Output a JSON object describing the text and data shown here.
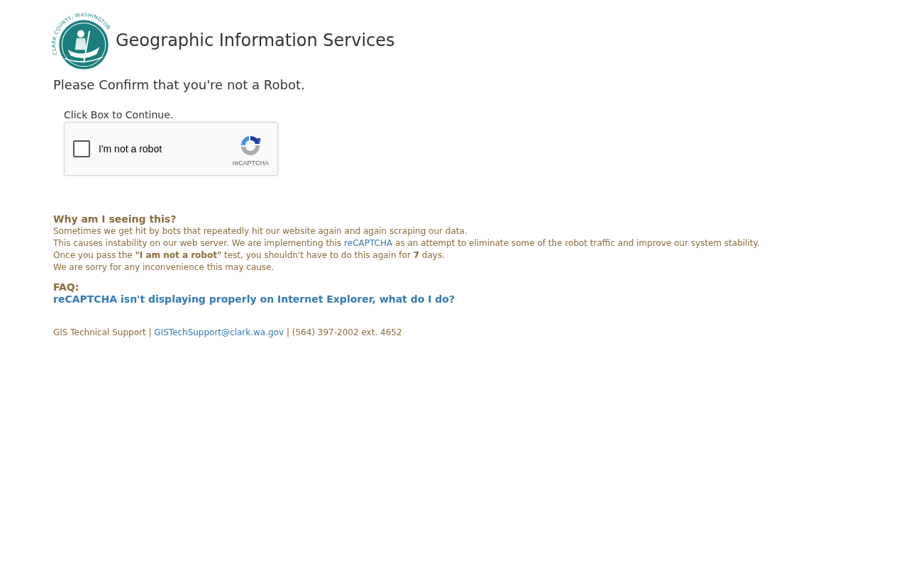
{
  "header": {
    "logo_text": "CLARK COUNTY, WASHINGTON",
    "title": "Geographic Information Services"
  },
  "prompt": "Please Confirm that you're not a Robot.",
  "captcha": {
    "instruction": "Click Box to Continue.",
    "label": "I'm not a robot",
    "checked": false,
    "brand": "reCAPTCHA"
  },
  "why": {
    "heading": "Why am I seeing this?",
    "lines": [
      {
        "text": "Sometimes we get hit by bots that repeatedly hit our website again and again scraping our data."
      },
      {
        "text": "This causes instability on our web server. We are implementing this ",
        "link": "reCAPTCHA",
        "after": " as an attempt to eliminate some of the robot traffic and improve our system stability."
      },
      {
        "text": "Once you pass the **\"I am not a robot\"** test, you shouldn't have to do this again for **7** days."
      },
      {
        "text": "We are sorry for any inconvenience this may cause."
      }
    ]
  },
  "faq": {
    "heading": "FAQ:",
    "link": "reCAPTCHA isn't displaying properly on Internet Explorer, what do I do?"
  },
  "footer": {
    "text": "GIS Technical Support | ",
    "link": "GISTechSupport@clark.wa.gov",
    "after": " | (564) 397-2002 ext. 4652"
  }
}
